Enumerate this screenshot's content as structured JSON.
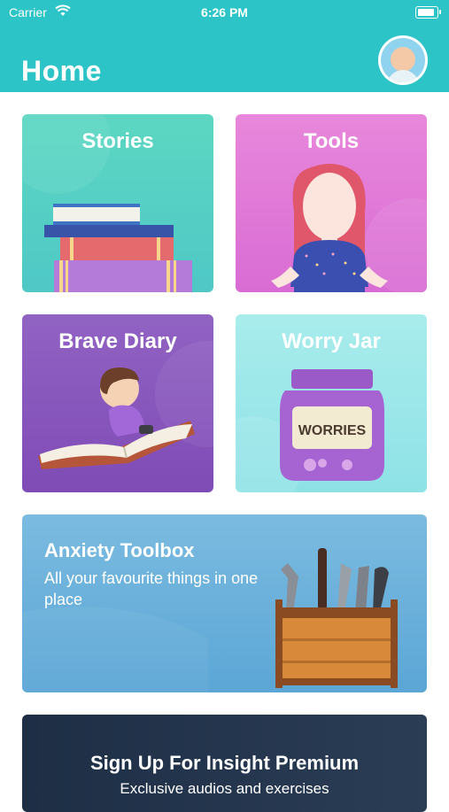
{
  "status_bar": {
    "carrier": "Carrier",
    "time": "6:26 PM"
  },
  "header": {
    "title": "Home"
  },
  "cards": {
    "stories": {
      "title": "Stories"
    },
    "tools": {
      "title": "Tools"
    },
    "brave_diary": {
      "title": "Brave Diary"
    },
    "worry_jar": {
      "title": "Worry Jar",
      "jar_label": "WORRIES"
    }
  },
  "anxiety_toolbox": {
    "title": "Anxiety Toolbox",
    "subtitle": "All your favourite things in one place"
  },
  "premium": {
    "title": "Sign Up For Insight Premium",
    "subtitle": "Exclusive audios and exercises"
  },
  "colors": {
    "header": "#2cc4c7",
    "stories": "#5cd7c2",
    "tools": "#e887db",
    "brave_diary": "#9163c3",
    "worry_jar": "#a9ecec",
    "toolbox": "#6fb3dd",
    "premium": "#1d2e45"
  }
}
